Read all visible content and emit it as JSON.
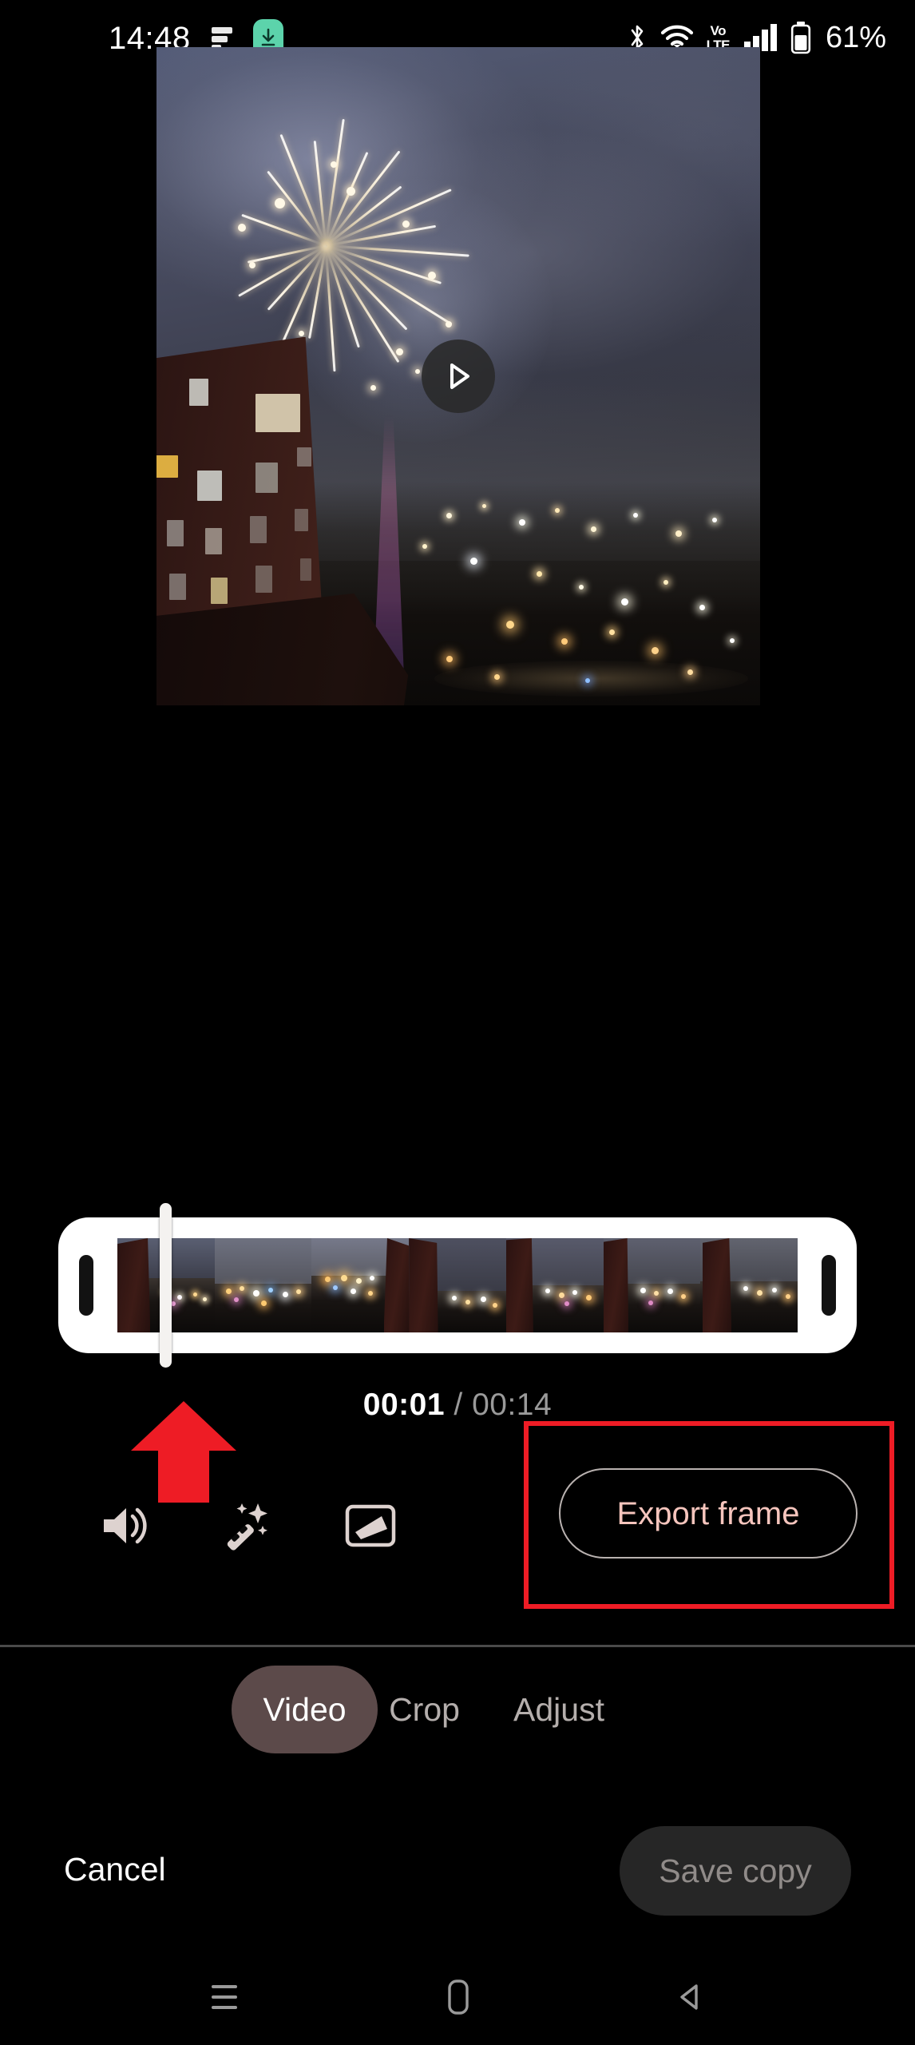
{
  "status_bar": {
    "time": "14:48",
    "icons_left": [
      "data-saver-icon",
      "download-badge-icon"
    ],
    "icons_right": [
      "bluetooth-icon",
      "wifi-icon",
      "volte-icon",
      "cellular-signal-icon",
      "battery-icon"
    ],
    "volte_top": "Vo",
    "volte_bottom": "LTE",
    "battery_percent": "61%"
  },
  "preview": {
    "play_button_label": "Play",
    "scene_description": "Fireworks over a dark brick apartment building at night with a lit city below"
  },
  "timeline": {
    "playhead_position_pct": 6,
    "left_handle_label": "Trim start",
    "right_handle_label": "Trim end",
    "frame_count": 7
  },
  "time": {
    "current": "00:01",
    "separator": "/",
    "total": "00:14"
  },
  "tools": [
    {
      "name": "volume-icon",
      "label": "Volume"
    },
    {
      "name": "magic-wand-icon",
      "label": "Enhance"
    },
    {
      "name": "stabilize-icon",
      "label": "Stabilize"
    }
  ],
  "export": {
    "label": "Export frame",
    "highlight_color": "#ee1c25",
    "text_color": "#f6c5bd",
    "border_color": "#b9b2b0"
  },
  "annotation": {
    "arrow_color": "#ee1c25",
    "arrow_direction": "up",
    "box_color": "#ee1c25"
  },
  "tabs": [
    {
      "label": "Video",
      "active": true
    },
    {
      "label": "Crop",
      "active": false
    },
    {
      "label": "Adjust",
      "active": false
    }
  ],
  "actions": {
    "cancel": "Cancel",
    "save": "Save copy",
    "save_enabled": false
  },
  "navbar": [
    {
      "name": "recents-icon",
      "label": "Recents"
    },
    {
      "name": "home-icon",
      "label": "Home"
    },
    {
      "name": "back-icon",
      "label": "Back"
    }
  ]
}
